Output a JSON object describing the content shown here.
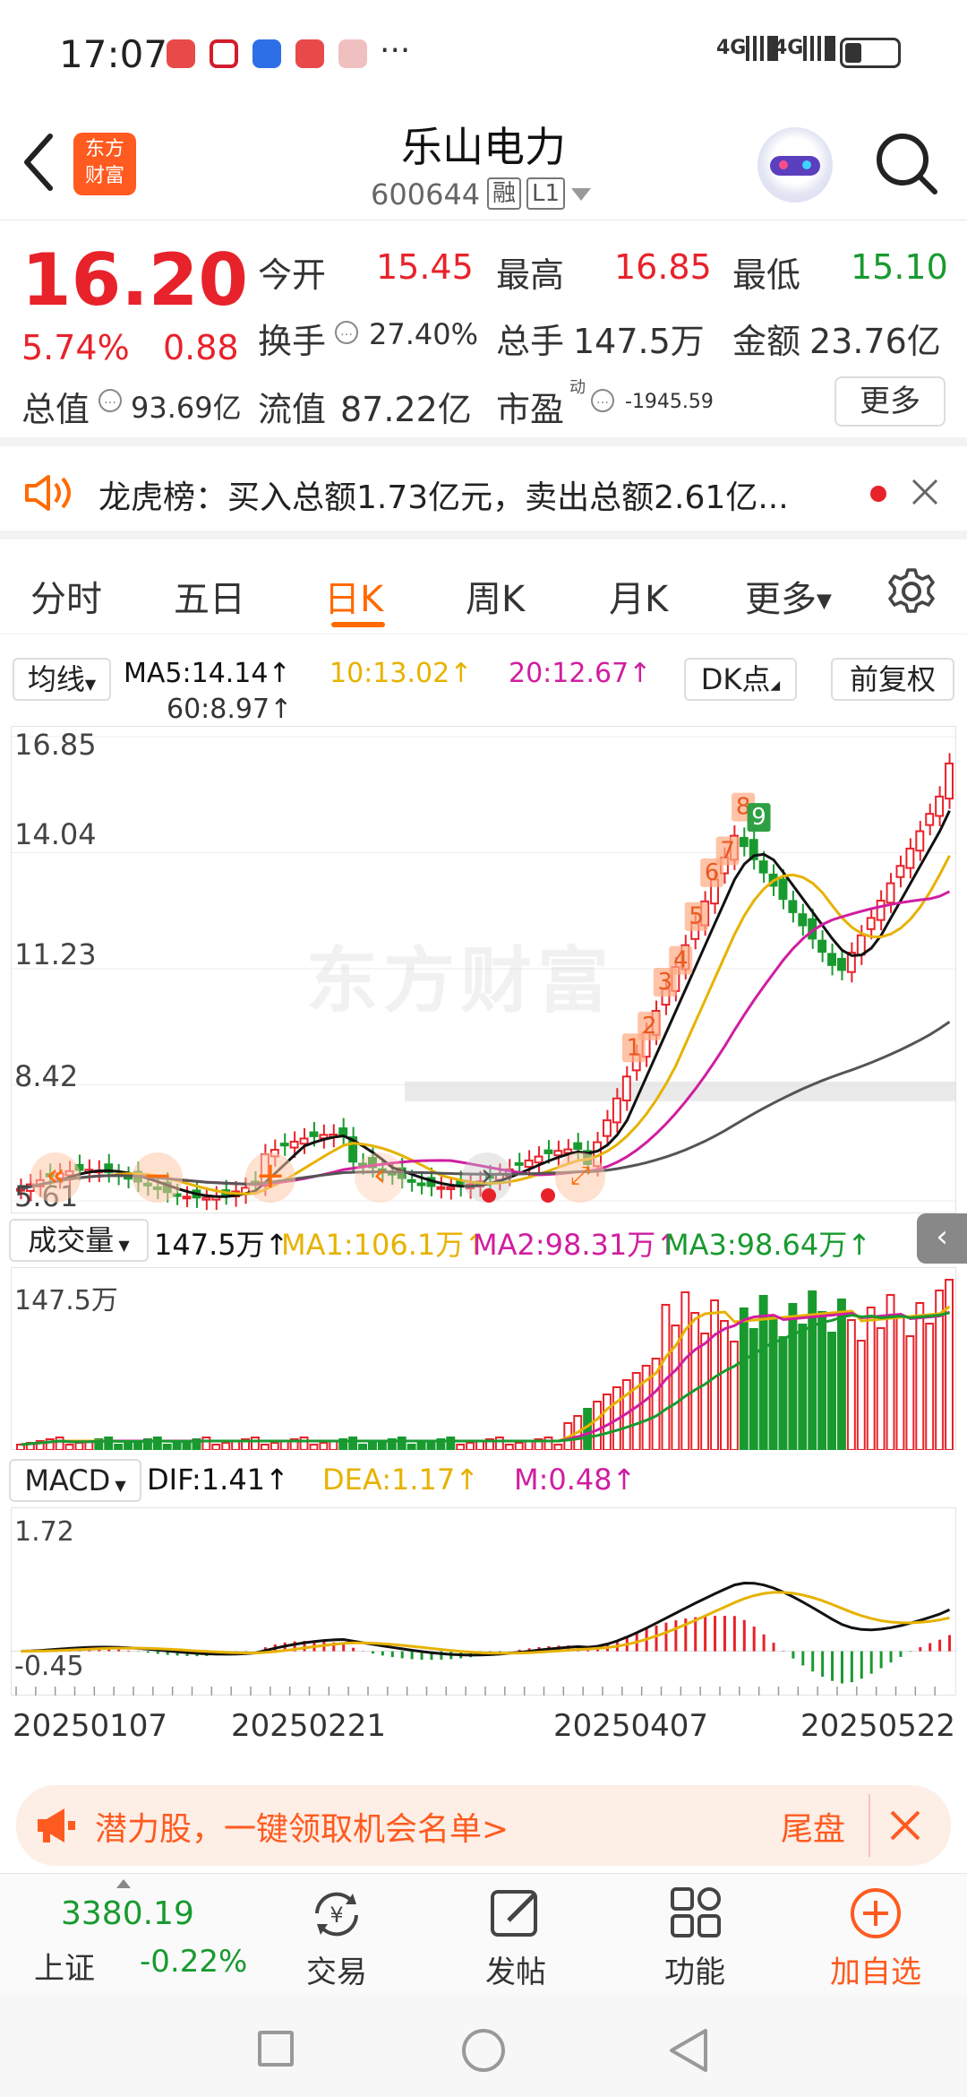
{
  "status_bar": {
    "time": "17:07",
    "signal1": "4G",
    "signal2": "4G"
  },
  "header": {
    "stock_name": "乐山电力",
    "stock_code": "600644",
    "tag_margin": "融",
    "tag_level": "L1",
    "logo_text_top": "东方",
    "logo_text_bottom": "财富"
  },
  "quote": {
    "price": "16.20",
    "change_pct": "5.74%",
    "change": "0.88",
    "open_label": "今开",
    "open": "15.45",
    "high_label": "最高",
    "high": "16.85",
    "low_label": "最低",
    "low": "15.10",
    "turnover_label": "换手",
    "turnover": "27.40%",
    "volume_label": "总手",
    "volume": "147.5万",
    "amount_label": "金额",
    "amount": "23.76亿",
    "mktcap_label": "总值",
    "mktcap": "93.69亿",
    "float_label": "流值",
    "float_cap": "87.22亿",
    "pe_label": "市盈",
    "pe_sup": "动",
    "pe": "-1945.59",
    "more_label": "更多"
  },
  "notice": {
    "label": "龙虎榜：买入总额1.73亿元，卖出总额2.61亿..."
  },
  "tabs": [
    {
      "label": "分时"
    },
    {
      "label": "五日"
    },
    {
      "label": "日K"
    },
    {
      "label": "周K"
    },
    {
      "label": "月K"
    },
    {
      "label": "更多"
    }
  ],
  "indicators": {
    "ma_selector": "均线",
    "ma5": "MA5:14.14↑",
    "ma10": "10:13.02↑",
    "ma20": "20:12.67↑",
    "ma60": "60:8.97↑",
    "dk_label": "DK点",
    "restore_label": "前复权",
    "vol_selector": "成交量",
    "vol_val": "147.5万↑",
    "vol_ma1": "MA1:106.1万↑",
    "vol_ma2": "MA2:98.31万↑",
    "vol_ma3": "MA3:98.64万↑",
    "macd_selector": "MACD",
    "dif": "DIF:1.41↑",
    "dea": "DEA:1.17↑",
    "m": "M:0.48↑",
    "vol_max_label": "147.5万",
    "macd_max_label": "1.72",
    "macd_min_label": "-0.45",
    "watermark": "东方财富"
  },
  "chart_data": {
    "type": "candlestick",
    "price_axis_labels": [
      "16.85",
      "14.04",
      "11.23",
      "8.42",
      "5.61"
    ],
    "ylim": [
      5.61,
      16.85
    ],
    "dates": [
      "20250107",
      "20250221",
      "20250407",
      "20250522"
    ],
    "last_close": 16.2,
    "td_counts_labels": [
      "1",
      "2",
      "3",
      "4",
      "5",
      "6",
      "7",
      "8",
      "9"
    ],
    "colors": {
      "up": "#e8222a",
      "down": "#189a2f",
      "ma5": "#111111",
      "ma10": "#e7b200",
      "ma20": "#d01ea0",
      "ma60": "#555555"
    }
  },
  "banner": {
    "text": "潜力股，一键领取机会名单>",
    "right_text": "尾盘"
  },
  "bottom_nav": {
    "index_value": "3380.19",
    "index_name": "上证",
    "index_change": "-0.22%",
    "trade": "交易",
    "post": "发帖",
    "func": "功能",
    "watch": "加自选"
  }
}
